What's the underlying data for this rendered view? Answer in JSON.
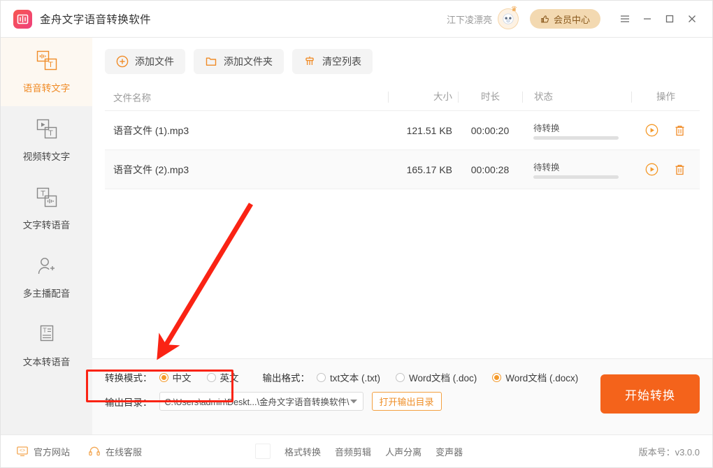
{
  "titlebar": {
    "app_name": "金舟文字语音转换软件",
    "username": "江下凌漂亮",
    "vip_label": "会员中心",
    "icons": {
      "menu": "menu-icon",
      "minimize": "minimize-icon",
      "maximize": "maximize-icon",
      "close": "close-icon"
    }
  },
  "sidebar": {
    "items": [
      {
        "label": "语音转文字",
        "icon": "audio-to-text-icon",
        "active": true
      },
      {
        "label": "视频转文字",
        "icon": "video-to-text-icon",
        "active": false
      },
      {
        "label": "文字转语音",
        "icon": "text-to-audio-icon",
        "active": false
      },
      {
        "label": "多主播配音",
        "icon": "multi-speaker-icon",
        "active": false
      },
      {
        "label": "文本转语音",
        "icon": "document-to-speech-icon",
        "active": false
      }
    ]
  },
  "toolbar": {
    "add_file": "添加文件",
    "add_folder": "添加文件夹",
    "clear_list": "清空列表"
  },
  "table": {
    "headers": {
      "name": "文件名称",
      "size": "大小",
      "duration": "时长",
      "status": "状态",
      "action": "操作"
    },
    "rows": [
      {
        "name": "语音文件 (1).mp3",
        "size": "121.51 KB",
        "duration": "00:00:20",
        "status": "待转换"
      },
      {
        "name": "语音文件 (2).mp3",
        "size": "165.17 KB",
        "duration": "00:00:28",
        "status": "待转换"
      }
    ]
  },
  "settings": {
    "mode_label": "转换模式：",
    "mode_options": [
      {
        "label": "中文",
        "selected": true
      },
      {
        "label": "英文",
        "selected": false
      }
    ],
    "format_label": "输出格式：",
    "format_options": [
      {
        "label": "txt文本 (.txt)",
        "selected": false
      },
      {
        "label": "Word文档 (.doc)",
        "selected": false
      },
      {
        "label": "Word文档 (.docx)",
        "selected": true
      }
    ],
    "outdir_label": "输出目录：",
    "outdir_value": "C:\\Users\\admin\\Deskt...\\金舟文字语音转换软件\\",
    "open_dir_label": "打开输出目录",
    "start_label": "开始转换"
  },
  "footer": {
    "website": "官方网站",
    "support": "在线客服",
    "tools": [
      "格式转换",
      "音频剪辑",
      "人声分离",
      "变声器"
    ],
    "version": "版本号：v3.0.0"
  },
  "annotations": {
    "accent_color": "#f08c28",
    "primary_button_color": "#f4631b",
    "highlight_color": "#fa2314"
  }
}
